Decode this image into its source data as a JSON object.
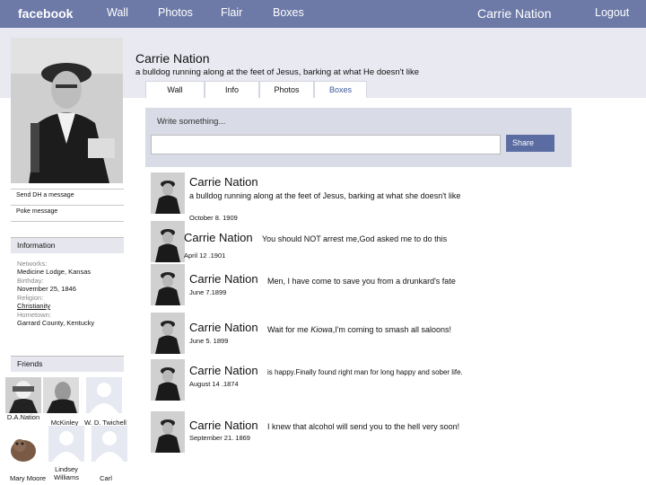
{
  "topbar": {
    "logo": "facebook",
    "nav": [
      "Wall",
      "Photos",
      "Flair",
      "Boxes"
    ],
    "username": "Carrie Nation",
    "logout": "Logout"
  },
  "profile": {
    "name": "Carrie Nation",
    "tagline": "a bulldog  running along at the feet of Jesus, barking at what He doesn't like",
    "tabs": [
      "Wall",
      "Info",
      "Photos",
      "Boxes"
    ]
  },
  "publisher": {
    "prompt": "Write something...",
    "share_label": "Share"
  },
  "sidebar": {
    "send_message": "Send DH a message",
    "poke": "Poke message",
    "information_title": "Information",
    "info": [
      {
        "label": "Networks:",
        "value": "Medicine Lodge, Kansas"
      },
      {
        "label": "Birthday:",
        "value": "November 25, 1846"
      },
      {
        "label": "Religion:",
        "value": "Christianity"
      },
      {
        "label": "Hometown:",
        "value": "Garrard County, Kentucky"
      }
    ],
    "friends_title": "Friends",
    "friends": [
      "D.A.Nation",
      "McKinley",
      "W. D. Twichell",
      "Mary Moore",
      "Lindsey Williams",
      "Carl"
    ]
  },
  "posts": [
    {
      "name": "Carrie Nation",
      "text": "a bulldog  running along at the feet of Jesus, barking at what she doesn't like",
      "date": "October 8. 1909"
    },
    {
      "name": "Carrie Nation",
      "text": "You should NOT arrest me,God asked me to do this",
      "date": "April 12 .1901"
    },
    {
      "name": "Carrie Nation",
      "text": "Men, I have come to save you from a drunkard's fate",
      "date": "June 7.1899"
    },
    {
      "name": "Carrie Nation",
      "text_pre": "Wait for me ",
      "text_em": "Kiowa",
      "text_post": ",I'm coming to smash  all saloons!",
      "date": "June 5. 1899"
    },
    {
      "name": "Carrie Nation",
      "text": "is happy.Finally found right man for long happy and sober life.",
      "date": "August 14 .1874"
    },
    {
      "name": "Carrie Nation",
      "text": " I knew that alcohol will send you to  the hell very soon!",
      "date": "September 21. 1869"
    }
  ]
}
